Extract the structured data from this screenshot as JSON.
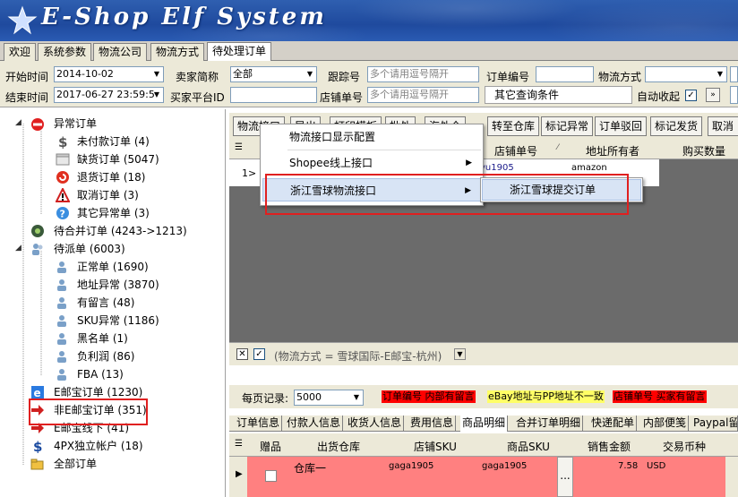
{
  "app": {
    "title": "E-Shop Elf System"
  },
  "tabs": [
    {
      "label": "欢迎"
    },
    {
      "label": "系统参数"
    },
    {
      "label": "物流公司"
    },
    {
      "label": "物流方式"
    },
    {
      "label": "待处理订单",
      "active": true
    }
  ],
  "filters": {
    "start_time_label": "开始时间",
    "start_time_value": "2014-10-02",
    "end_time_label": "结束时间",
    "end_time_value": "2017-06-27 23:59:5",
    "seller_label": "卖家简称",
    "seller_value": "全部",
    "buyer_platform_id_label": "买家平台ID",
    "buyer_platform_id_value": "",
    "tracking_label": "跟踪号",
    "tracking_placeholder": "多个请用逗号隔开",
    "store_order_label": "店铺单号",
    "store_order_placeholder": "多个请用逗号隔开",
    "order_no_label": "订单编号",
    "order_no_value": "",
    "shipping_method_label": "物流方式",
    "shipping_method_value": "",
    "other_query_label": "其它查询条件",
    "auto_collapse_label": "自动收起",
    "auto_collapse_checked": true
  },
  "tree": {
    "items": [
      {
        "label": "异常订单",
        "icon": "no-entry-icon"
      },
      {
        "label": "未付款订单 (4)",
        "icon": "dollar-icon"
      },
      {
        "label": "缺货订单 (5047)",
        "icon": "box-icon"
      },
      {
        "label": "退货订单 (18)",
        "icon": "return-icon"
      },
      {
        "label": "取消订单 (3)",
        "icon": "warning-icon"
      },
      {
        "label": "其它异常单 (3)",
        "icon": "question-icon"
      },
      {
        "label": "待合并订单 (4243->1213)",
        "icon": "merge-icon"
      },
      {
        "label": "待派单 (6003)",
        "icon": "users-icon"
      },
      {
        "label": "正常单 (1690)",
        "icon": "user-icon"
      },
      {
        "label": "地址异常 (3870)",
        "icon": "user-icon"
      },
      {
        "label": "有留言 (48)",
        "icon": "user-icon"
      },
      {
        "label": "SKU异常 (1186)",
        "icon": "user-icon"
      },
      {
        "label": "黑名单 (1)",
        "icon": "user-icon"
      },
      {
        "label": "负利润 (86)",
        "icon": "user-icon"
      },
      {
        "label": "FBA (13)",
        "icon": "user-icon"
      },
      {
        "label": "E邮宝订单 (1230)",
        "icon": "ie-icon"
      },
      {
        "label": "非E邮宝订单 (351)",
        "icon": "arrow-icon"
      },
      {
        "label": "E邮宝线下 (41)",
        "icon": "arrow-icon"
      },
      {
        "label": "4PX独立帐户 (18)",
        "icon": "dollar-icon"
      },
      {
        "label": "全部订单",
        "icon": "folder-icon"
      }
    ]
  },
  "toolbar": {
    "buttons": [
      "物流接口",
      "导出",
      "打印模板",
      "批处",
      "海外仓",
      "转至仓库",
      "标记异常",
      "订单驳回",
      "标记发货",
      "取消"
    ]
  },
  "grid": {
    "columns": [
      "店铺单号",
      "地址所有者",
      "购买数量"
    ],
    "row_indicator": "1>",
    "row": {
      "store_order": "yu1905",
      "owner": "amazon"
    }
  },
  "context_menu": {
    "items": [
      {
        "label": "物流接口显示配置",
        "has_submenu": false
      },
      {
        "label": "Shopee线上接口",
        "has_submenu": true
      },
      {
        "label": "浙江雪球物流接口",
        "has_submenu": true,
        "highlighted": true
      }
    ],
    "submenu": {
      "items": [
        {
          "label": "浙江雪球提交订单"
        }
      ]
    }
  },
  "filter_bar": {
    "text": "(物流方式 = 雪球国际-E邮宝-杭州)"
  },
  "page_bar": {
    "per_page_label": "每页记录:",
    "per_page_value": "5000",
    "badges": [
      {
        "text": "订单编号 内部有留言",
        "bg": "#ff0000",
        "fg": "#000000"
      },
      {
        "text": "eBay地址与PP地址不一致",
        "bg": "#ffff66",
        "fg": "#000000"
      },
      {
        "text": "店铺单号 买家有留言",
        "bg": "#ff0000",
        "fg": "#000000"
      }
    ]
  },
  "subtabs": [
    "订单信息",
    "付款人信息",
    "收货人信息",
    "费用信息",
    "商品明细",
    "合并订单明细",
    "快递配单",
    "内部便笺",
    "Paypal留"
  ],
  "detail": {
    "columns": [
      "赠品",
      "出货仓库",
      "店铺SKU",
      "商品SKU",
      "销售金额",
      "交易币种"
    ],
    "row": {
      "warehouse": "仓库一",
      "store_sku": "gaga1905",
      "product_sku": "gaga1905",
      "ellipsis": "...",
      "amount": "7.58",
      "currency": "USD"
    }
  },
  "colors": {
    "banner": "#1f4a9e",
    "highlight_row": "#ff8080",
    "annotation": "#e02020"
  }
}
